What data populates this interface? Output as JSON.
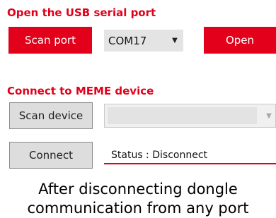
{
  "usb_section": {
    "heading": "Open the USB serial port",
    "scan_port_label": "Scan port",
    "port_value": "COM17",
    "open_label": "Open"
  },
  "meme_section": {
    "heading": "Connect to MEME device",
    "scan_device_label": "Scan device",
    "device_value": "",
    "connect_label": "Connect",
    "status_text": "Status : Disconnect"
  },
  "caption": {
    "line1": "After disconnecting dongle",
    "line2": "communication from any port"
  },
  "colors": {
    "accent": "#e2001a",
    "button_gray": "#dddddd",
    "combo_gray": "#e4e4e4"
  }
}
